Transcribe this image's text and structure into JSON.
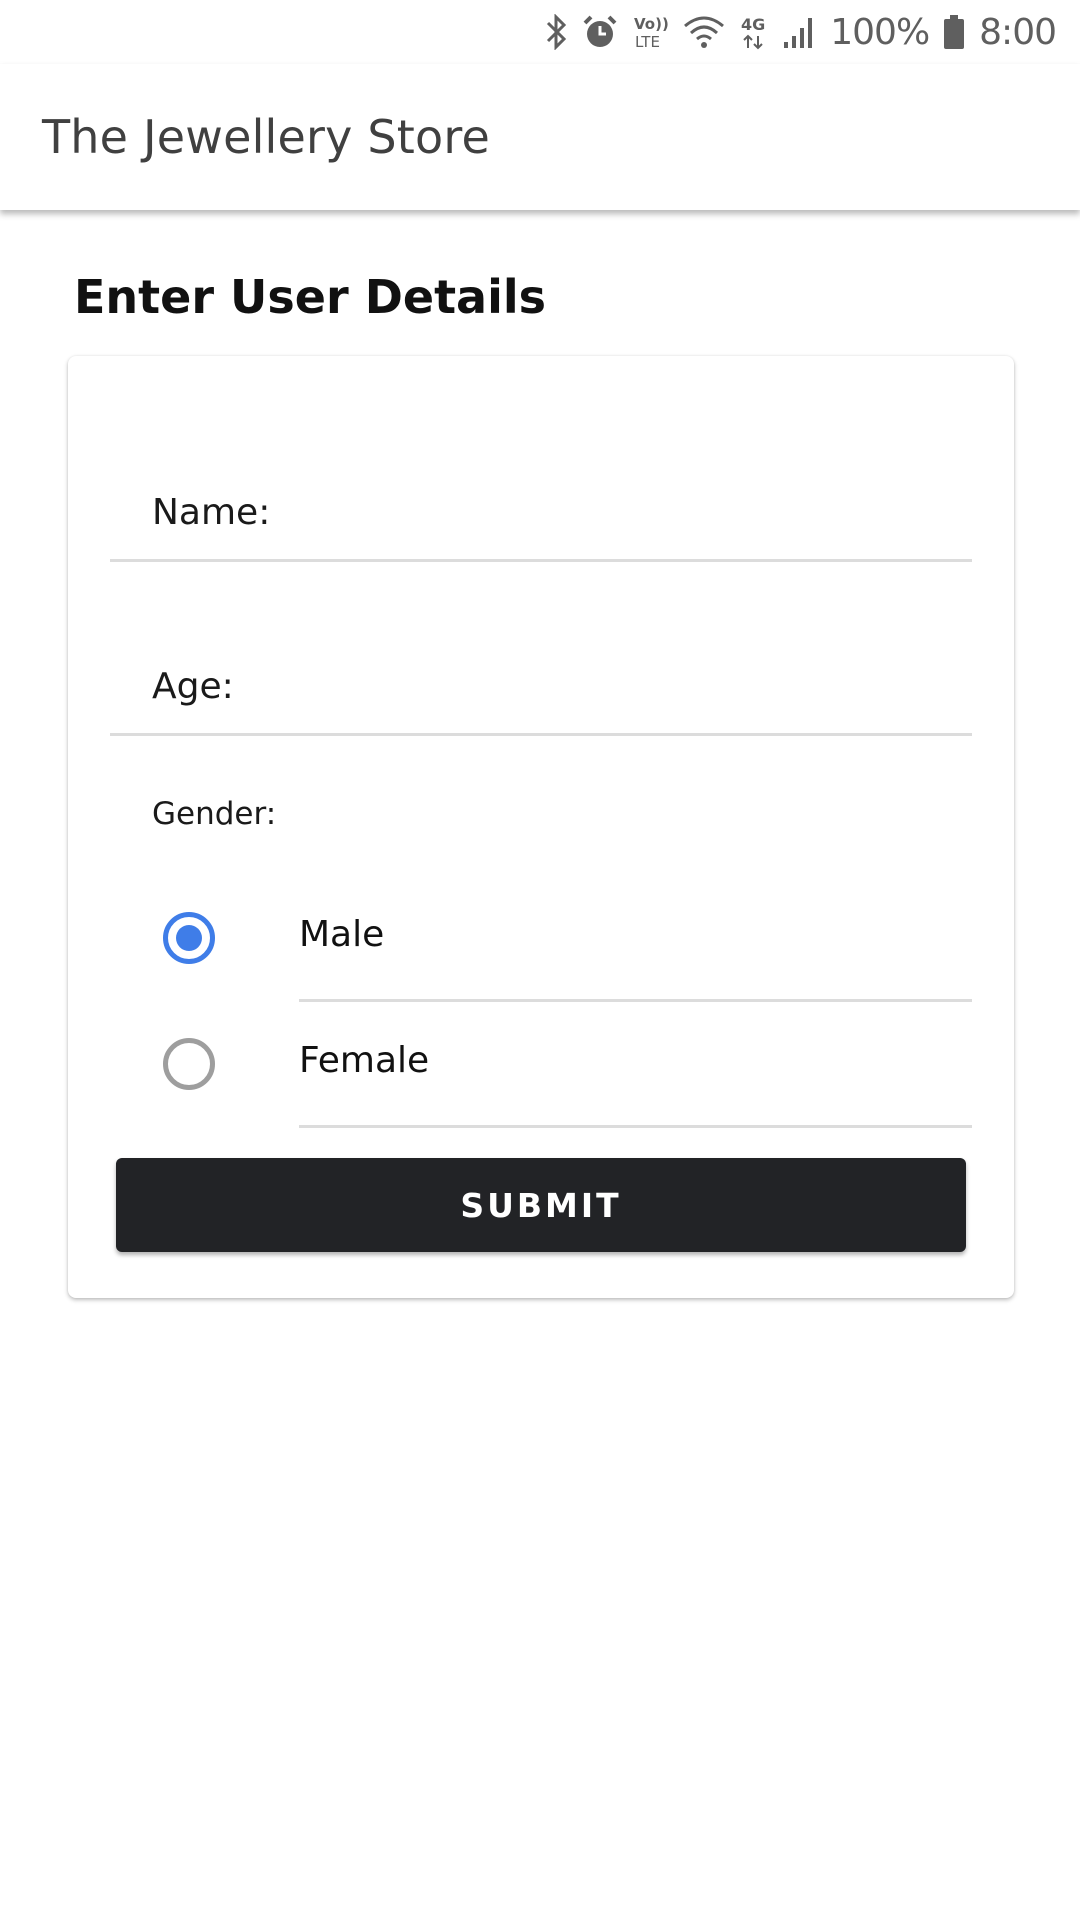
{
  "status_bar": {
    "icons": [
      "bluetooth-icon",
      "alarm-icon",
      "volte-icon",
      "wifi-icon",
      "4g-icon",
      "signal-icon",
      "battery-icon"
    ],
    "volte_text": "Vo)) LTE",
    "network_text": "4G",
    "battery_percent": "100%",
    "time": "8:00"
  },
  "app_bar": {
    "title": "The Jewellery Store"
  },
  "form": {
    "heading": "Enter User Details",
    "name_label": "Name:",
    "name_value": "",
    "age_label": "Age:",
    "age_value": "",
    "gender_label": "Gender:",
    "gender_options": [
      {
        "label": "Male",
        "selected": true
      },
      {
        "label": "Female",
        "selected": false
      }
    ],
    "submit_label": "SUBMIT"
  },
  "colors": {
    "accent": "#3f7de8",
    "button_bg": "#222326",
    "divider": "#dcdcdc"
  }
}
